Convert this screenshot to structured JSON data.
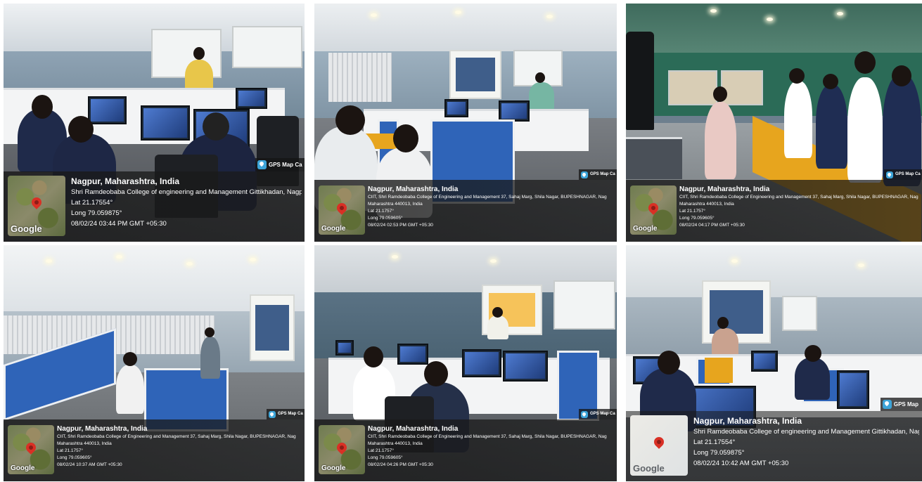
{
  "photos": [
    {
      "city": "Nagpur, Maharashtra, India",
      "address": "Shri Ramdeobaba College of engineering and Management Gittikhadan, Nagp",
      "address2": "",
      "lat": "Lat 21.17554°",
      "long": "Long 79.059875°",
      "datetime": "08/02/24 03:44 PM GMT +05:30",
      "map_label": "Google",
      "badge": "GPS Map Ca"
    },
    {
      "city": "Nagpur, Maharashtra, India",
      "address": "CIIT, Shri Ramdeobaba College of Engineering and Management 37, Sahaj Marg, Shila Nagar, BUPESHNAGAR, Nag",
      "address2": "Maharashtra 440013, India",
      "lat": "Lat 21.1757°",
      "long": "Long 79.059605°",
      "datetime": "08/02/24 02:53 PM GMT +05:30",
      "map_label": "Google",
      "badge": "GPS Map Ca"
    },
    {
      "city": "Nagpur, Maharashtra, India",
      "address": "CIIT, Shri Ramdeobaba College of Engineering and Management 37, Sahaj Marg, Shila Nagar, BUPESHNAGAR, Nag",
      "address2": "Maharashtra 440013, India",
      "lat": "Lat 21.1757°",
      "long": "Long 79.059605°",
      "datetime": "08/02/24 04:17 PM GMT +05:30",
      "map_label": "Google",
      "badge": "GPS Map Ca"
    },
    {
      "city": "Nagpur, Maharashtra, India",
      "address": "CIIT, Shri Ramdeobaba College of Engineering and Management 37, Sahaj Marg, Shila Nagar, BUPESHNAGAR, Nag",
      "address2": "Maharashtra 440013, India",
      "lat": "Lat 21.1757°",
      "long": "Long 79.059605°",
      "datetime": "08/02/24 10:37 AM GMT +05:30",
      "map_label": "Google",
      "badge": "GPS Map Ca"
    },
    {
      "city": "Nagpur, Maharashtra, India",
      "address": "CIIT, Shri Ramdeobaba College of Engineering and Management 37, Sahaj Marg, Shila Nagar, BUPESHNAGAR, Nag",
      "address2": "Maharashtra 440013, India",
      "lat": "Lat 21.1757°",
      "long": "Long 79.059605°",
      "datetime": "08/02/24 04:26 PM GMT +05:30",
      "map_label": "Google",
      "badge": "GPS Map Ca"
    },
    {
      "city": "Nagpur, Maharashtra, India",
      "address": "Shri Ramdeobaba College of engineering and Management Gittikhadan, Nagp",
      "address2": "",
      "lat": "Lat 21.17554°",
      "long": "Long 79.059875°",
      "datetime": "08/02/24 10:42 AM GMT +05:30",
      "map_label": "Google",
      "badge": "GPS Map"
    }
  ],
  "colors": {
    "partition_blue": "#2f64b8",
    "overlay_bg": "#191919",
    "pin_red": "#d93025",
    "tray_yellow": "#e7a51e"
  }
}
